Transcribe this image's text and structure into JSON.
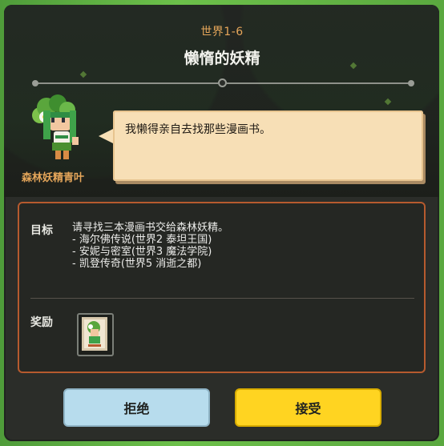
{
  "header": {
    "world_label": "世界1-6",
    "title": "懒惰的妖精"
  },
  "npc": {
    "name": "森林妖精青叶",
    "portrait_icon": "forest-fairy-portrait-icon",
    "dialogue": "我懒得亲自去找那些漫画书。"
  },
  "quest": {
    "goal_label": "目标",
    "goal_intro": "请寻找三本漫画书交给森林妖精。",
    "goal_items": [
      "- 海尔佛传说(世界2 泰坦王国)",
      "- 安妮与密室(世界3 魔法学院)",
      "- 凯登传奇(世界5 消逝之都)"
    ],
    "reward_label": "奖励",
    "reward_icon": "fairy-card-icon"
  },
  "buttons": {
    "reject": "拒绝",
    "accept": "接受"
  },
  "colors": {
    "accent_orange": "#e5a65a",
    "accept_yellow": "#ffd421",
    "reject_blue": "#b7dced",
    "quest_border": "#b65a2e",
    "speech_bg": "#f7dfb6"
  }
}
